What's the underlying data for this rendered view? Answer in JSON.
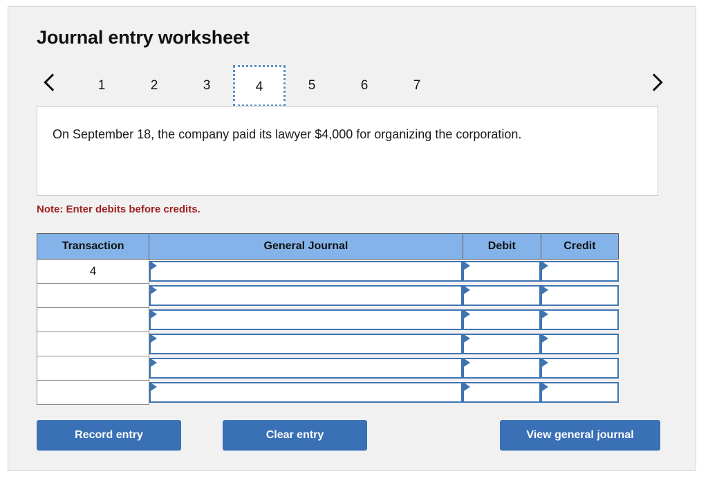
{
  "header": {
    "title": "Journal entry worksheet"
  },
  "pager": {
    "prev_icon": "chevron-left-icon",
    "next_icon": "chevron-right-icon",
    "tabs": [
      {
        "label": "1",
        "active": false
      },
      {
        "label": "2",
        "active": false
      },
      {
        "label": "3",
        "active": false
      },
      {
        "label": "4",
        "active": true
      },
      {
        "label": "5",
        "active": false
      },
      {
        "label": "6",
        "active": false
      },
      {
        "label": "7",
        "active": false
      }
    ]
  },
  "transaction": {
    "description": "On September 18, the company paid its lawyer $4,000 for organizing the corporation.",
    "note": "Note: Enter debits before credits."
  },
  "table": {
    "columns": [
      "Transaction",
      "General Journal",
      "Debit",
      "Credit"
    ],
    "rows": [
      {
        "transaction": "4",
        "general_journal": "",
        "debit": "",
        "credit": ""
      },
      {
        "transaction": "",
        "general_journal": "",
        "debit": "",
        "credit": ""
      },
      {
        "transaction": "",
        "general_journal": "",
        "debit": "",
        "credit": ""
      },
      {
        "transaction": "",
        "general_journal": "",
        "debit": "",
        "credit": ""
      },
      {
        "transaction": "",
        "general_journal": "",
        "debit": "",
        "credit": ""
      },
      {
        "transaction": "",
        "general_journal": "",
        "debit": "",
        "credit": ""
      }
    ]
  },
  "actions": {
    "record_label": "Record entry",
    "clear_label": "Clear entry",
    "view_label": "View general journal"
  },
  "colors": {
    "header_blue": "#83b3e8",
    "button_blue": "#3a70b5",
    "field_border": "#3f74b1",
    "note_red": "#9e2020",
    "card_bg": "#f1f1f1"
  }
}
